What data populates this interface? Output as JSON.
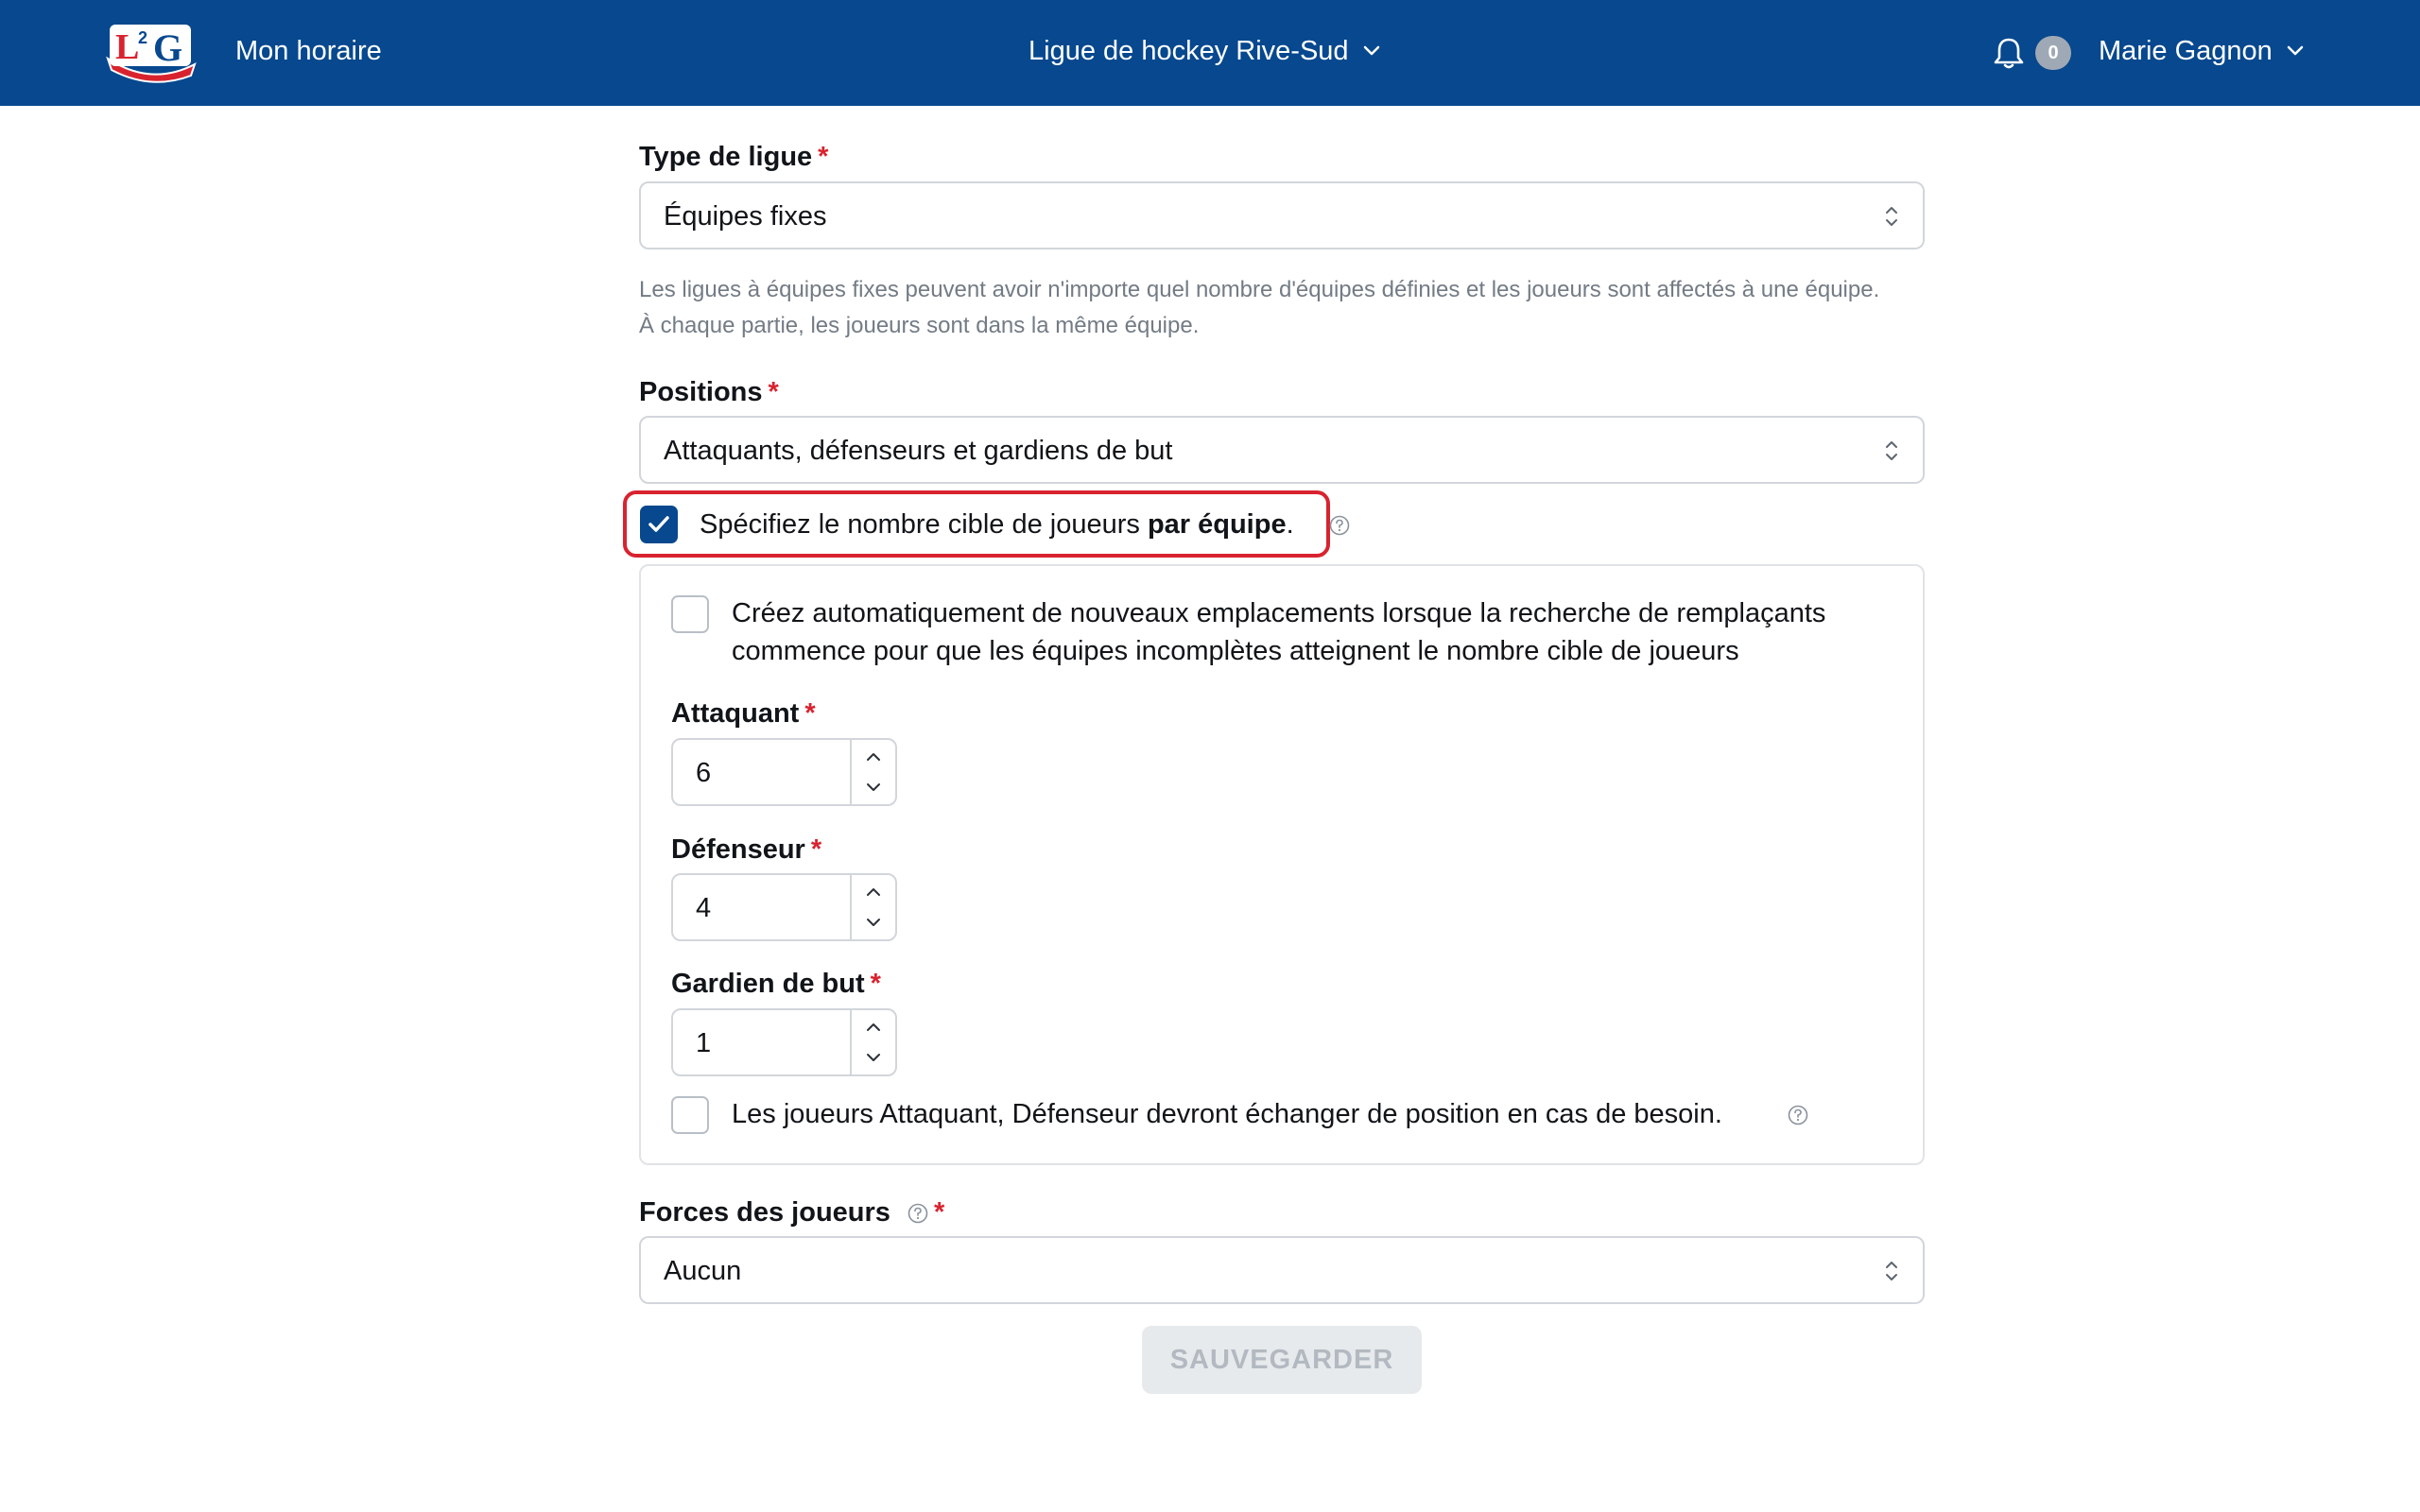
{
  "header": {
    "logo_text": "L²G",
    "nav_link": "Mon horaire",
    "league": "Ligue de hockey Rive-Sud",
    "notification_count": "0",
    "user_name": "Marie Gagnon",
    "brand_color": "#07488e"
  },
  "form": {
    "league_type": {
      "label": "Type de ligue",
      "required": "*",
      "value": "Équipes fixes",
      "help": "Les ligues à équipes fixes peuvent avoir n'importe quel nombre d'équipes définies et les joueurs sont affectés à une équipe. À chaque partie, les joueurs sont dans la même équipe."
    },
    "positions": {
      "label": "Positions",
      "required": "*",
      "value": "Attaquants, défenseurs et gardiens de but"
    },
    "target_per_team": {
      "checked": true,
      "label_prefix": "Spécifiez le nombre cible de joueurs ",
      "label_bold": "par équipe",
      "label_suffix": "."
    },
    "auto_create": {
      "checked": false,
      "label": "Créez automatiquement de nouveaux emplacements lorsque la recherche de remplaçants commence pour que les équipes incomplètes atteignent le nombre cible de joueurs"
    },
    "attaquant": {
      "label": "Attaquant",
      "required": "*",
      "value": "6"
    },
    "defenseur": {
      "label": "Défenseur",
      "required": "*",
      "value": "4"
    },
    "gardien": {
      "label": "Gardien de but",
      "required": "*",
      "value": "1"
    },
    "swap_positions": {
      "checked": false,
      "label": "Les joueurs Attaquant, Défenseur devront échanger de position en cas de besoin."
    },
    "player_strength": {
      "label": "Forces des joueurs",
      "required": "*",
      "value": "Aucun"
    },
    "save_label": "SAUVEGARDER"
  }
}
